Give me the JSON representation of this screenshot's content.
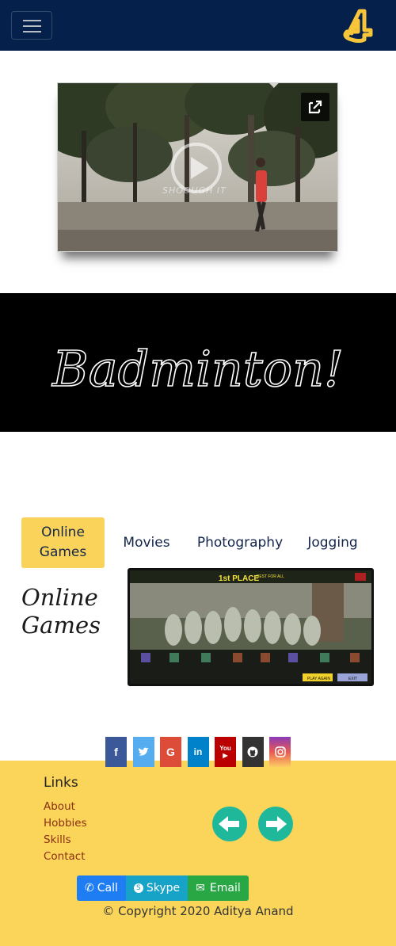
{
  "navbar": {
    "brand_letter": "A",
    "toggle_label": "Toggle navigation"
  },
  "video": {
    "watermark": "SHOOUGH IT"
  },
  "banner": {
    "title": "Badminton!"
  },
  "tabs": [
    {
      "label_line1": "Online",
      "label_line2": "Games"
    },
    {
      "label_line1": "Movies"
    },
    {
      "label_line1": "Photography"
    },
    {
      "label_line1": "Jogging"
    }
  ],
  "content": {
    "title_line1": "Online",
    "title_line2": "Games",
    "game": {
      "place": "1st PLACE",
      "place_sub": "BEST FOR ALL",
      "play_again": "PLAY AGAIN",
      "exit": "EXIT"
    }
  },
  "social": [
    {
      "name": "facebook",
      "glyph": "f",
      "color": "#3b5998"
    },
    {
      "name": "twitter",
      "glyph": "t",
      "color": "#55acee"
    },
    {
      "name": "google",
      "glyph": "G",
      "color": "#dd4b39"
    },
    {
      "name": "linkedin",
      "glyph": "in",
      "color": "#0082ca"
    },
    {
      "name": "youtube",
      "glyph": "You",
      "color": "#bb0000"
    },
    {
      "name": "github",
      "glyph": "gh",
      "color": "#333333"
    },
    {
      "name": "instagram",
      "glyph": "ig",
      "color": "#ac2bac"
    }
  ],
  "footer": {
    "links_title": "Links",
    "links": [
      "About",
      "Hobbies",
      "Skills",
      "Contact"
    ],
    "call": "Call",
    "skype": "Skype",
    "email": "Email",
    "copyright": "© Copyright 2020 Aditya Anand"
  },
  "colors": {
    "navbar": "#05204a",
    "accent": "#fad55a",
    "arrow": "#20b89a"
  }
}
